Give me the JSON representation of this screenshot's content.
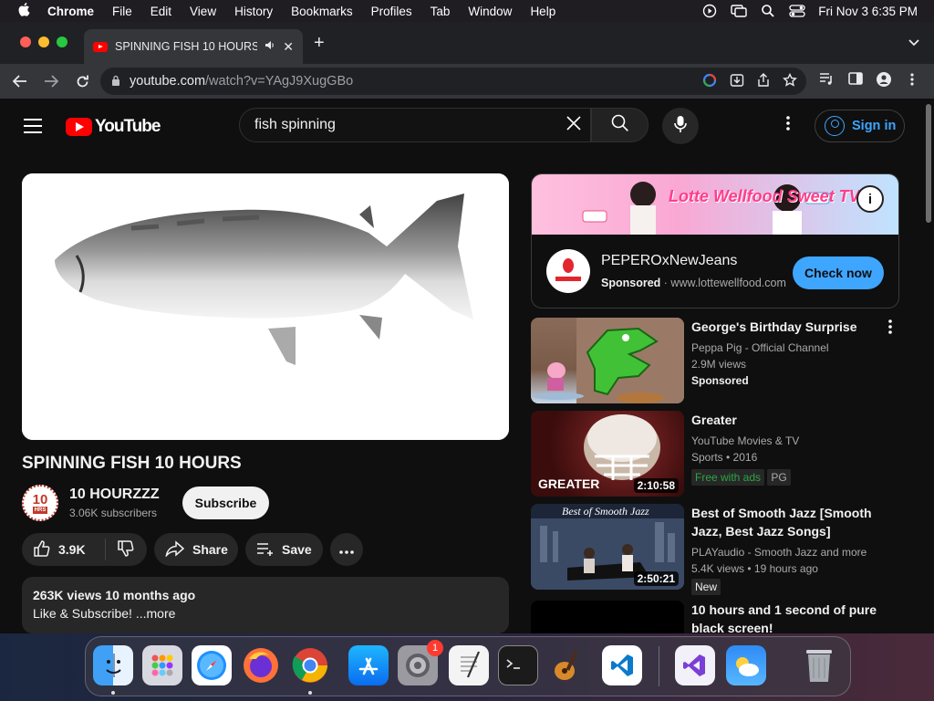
{
  "menubar": {
    "app_name": "Chrome",
    "items": [
      "File",
      "Edit",
      "View",
      "History",
      "Bookmarks",
      "Profiles",
      "Tab",
      "Window",
      "Help"
    ],
    "clock": "Fri Nov 3  6:35 PM"
  },
  "browser": {
    "tab_title": "SPINNING FISH 10 HOURS",
    "url_host": "youtube.com",
    "url_path": "/watch?v=YAgJ9XugGBo"
  },
  "youtube": {
    "logo_text": "YouTube",
    "search_value": "fish spinning",
    "sign_in": "Sign in"
  },
  "video": {
    "title": "SPINNING FISH 10 HOURS",
    "channel_name": "10 HOURZZZ",
    "channel_avatar_number": "10",
    "channel_avatar_text": "HRS",
    "subscribers": "3.06K subscribers",
    "subscribe_label": "Subscribe",
    "likes": "3.9K",
    "share_label": "Share",
    "save_label": "Save",
    "views_date": "263K views  10 months ago",
    "description": "Like & Subscribe! ",
    "more_label": "...more"
  },
  "ad": {
    "banner_text": "Lotte Wellfood Sweet TV",
    "advertiser": "PEPEROxNewJeans",
    "sponsored_label": "Sponsored",
    "domain": "www.lottewellfood.com",
    "cta": "Check now",
    "info_glyph": "i"
  },
  "related": [
    {
      "title": "George's Birthday Surprise",
      "channel": "Peppa Pig - Official Channel",
      "stats": "2.9M views",
      "extra": "Sponsored"
    },
    {
      "title": "Greater",
      "channel": "YouTube Movies & TV",
      "stats": "Sports • 2016",
      "badge1": "Free with ads",
      "badge2": "PG",
      "duration": "2:10:58",
      "thumb_text": "GREATER"
    },
    {
      "title": "Best of Smooth Jazz [Smooth Jazz, Best Jazz Songs]",
      "channel": "PLAYaudio - Smooth Jazz and more",
      "stats": "5.4K views  • 19 hours ago",
      "badge1": "New",
      "duration": "2:50:21",
      "thumb_text": "Best of Smooth Jazz"
    },
    {
      "title": "10 hours and 1 second of pure black screen!"
    }
  ],
  "dock": {
    "settings_badge": "1",
    "apps": [
      "finder",
      "launchpad",
      "safari",
      "firefox",
      "chrome",
      "app-store",
      "system-settings",
      "textedit",
      "terminal",
      "garageband",
      "vscode",
      "visual-studio",
      "weather",
      "trash"
    ]
  },
  "colors": {
    "background": "#0f0f0f",
    "accent_blue": "#3ea6ff",
    "youtube_red": "#ff0000",
    "free_with_ads_green": "#2ba640"
  }
}
